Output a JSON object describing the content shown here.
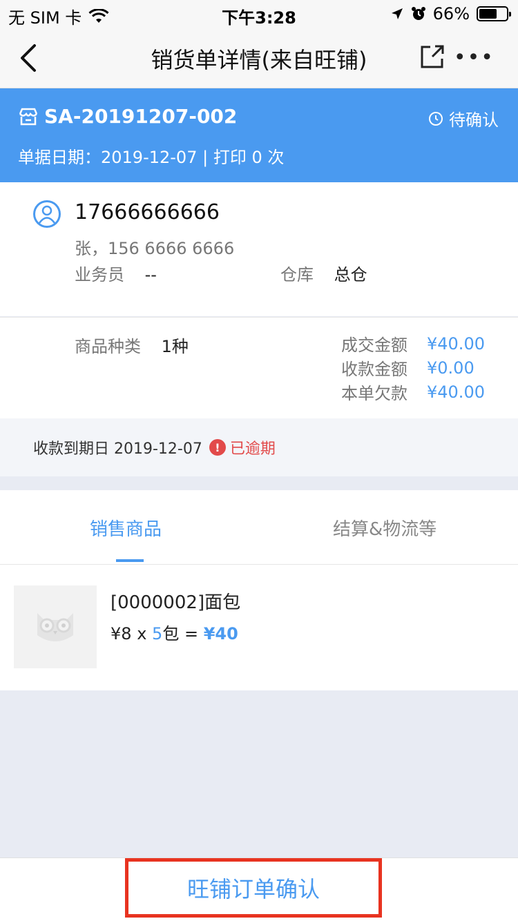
{
  "status_bar": {
    "carrier": "无 SIM 卡",
    "time": "下午3:28",
    "battery": "66%",
    "battery_level": 0.66
  },
  "nav": {
    "title": "销货单详情(来自旺铺)"
  },
  "order": {
    "code": "SA-20191207-002",
    "status": "待确认",
    "date_line": "单据日期：2019-12-07 | 打印 0 次"
  },
  "customer": {
    "phone": "17666666666",
    "contact": "张，156 6666 6666",
    "salesperson_label": "业务员",
    "salesperson_value": "--",
    "warehouse_label": "仓库",
    "warehouse_value": "总仓"
  },
  "summary": {
    "kind_label": "商品种类",
    "kind_value": "1种",
    "deal_label": "成交金额",
    "deal_value": "¥40.00",
    "received_label": "收款金额",
    "received_value": "¥0.00",
    "owed_label": "本单欠款",
    "owed_value": "¥40.00"
  },
  "due": {
    "text": "收款到期日 2019-12-07",
    "overdue": "已逾期"
  },
  "tabs": {
    "active": "销售商品",
    "inactive": "结算&物流等"
  },
  "product": {
    "name": "[0000002]面包",
    "unit_price": "¥8",
    "times": "x",
    "qty": "5",
    "unit": "包",
    "equals": "=",
    "total": "¥40"
  },
  "bottom": {
    "confirm_label": "旺铺订单确认"
  },
  "colors": {
    "accent": "#4a9af0",
    "danger": "#e24a4a",
    "highlight_border": "#e83320"
  }
}
